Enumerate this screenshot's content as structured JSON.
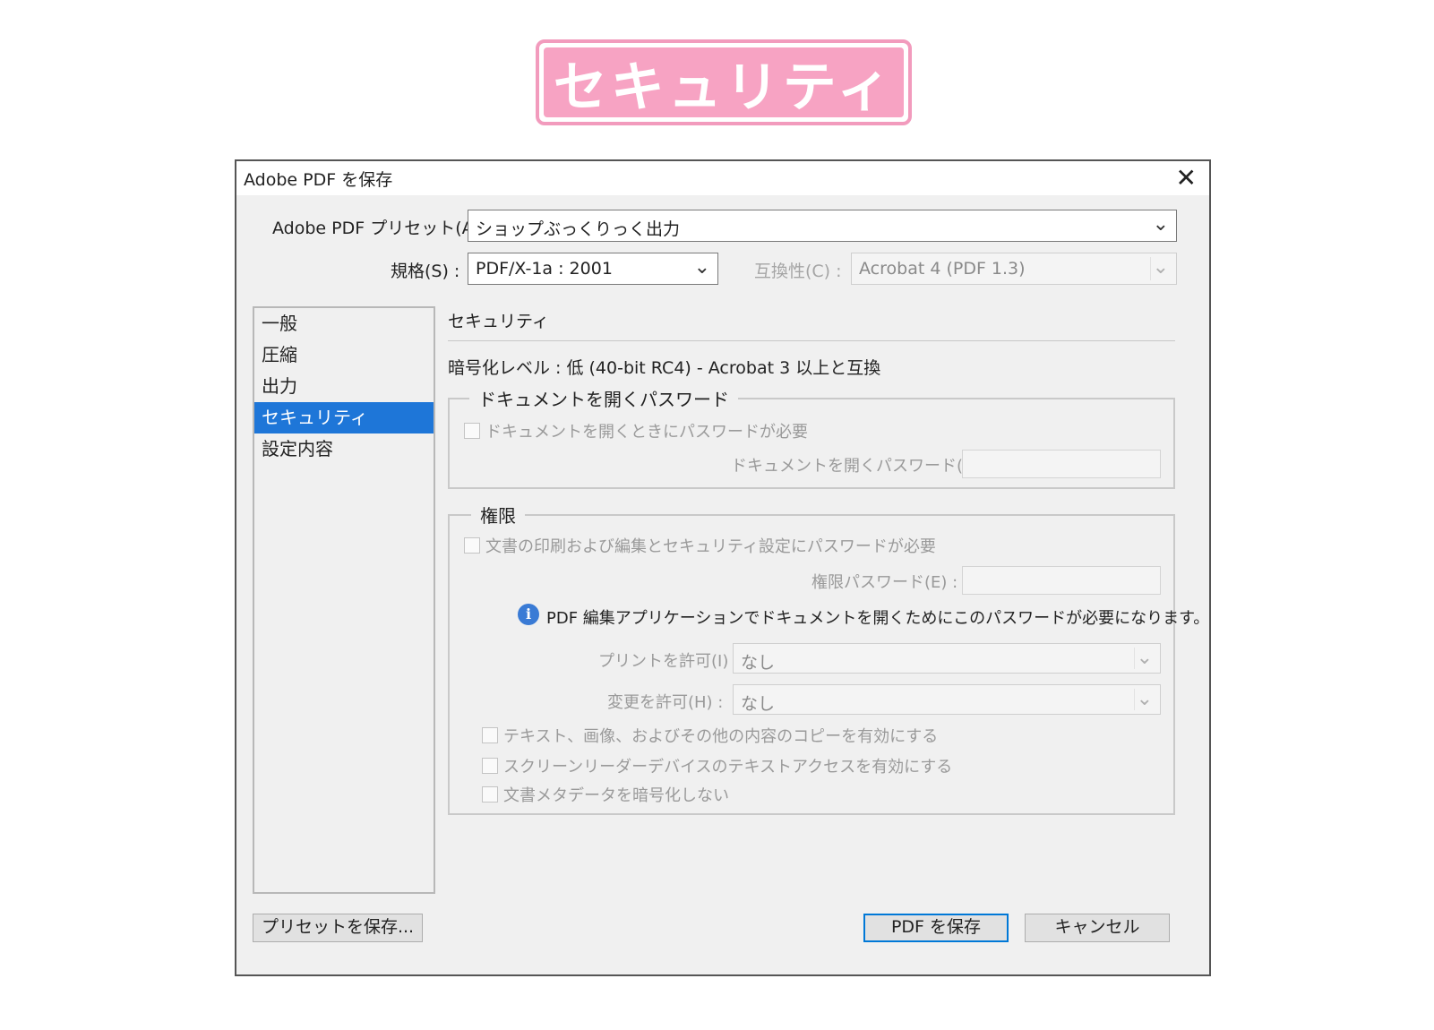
{
  "banner": {
    "title": "セキュリティ"
  },
  "dialog": {
    "title": "Adobe PDF を保存",
    "preset": {
      "label": "Adobe PDF プリセット(A) :",
      "value": "ショップぶっくりっく出力"
    },
    "standard": {
      "label": "規格(S) :",
      "value": "PDF/X-1a : 2001"
    },
    "compatibility": {
      "label": "互換性(C) :",
      "value": "Acrobat 4 (PDF 1.3)"
    }
  },
  "sidebar": {
    "items": [
      {
        "label": "一般"
      },
      {
        "label": "圧縮"
      },
      {
        "label": "出力"
      },
      {
        "label": "セキュリティ"
      },
      {
        "label": "設定内容"
      }
    ]
  },
  "security": {
    "section_title": "セキュリティ",
    "encryption_level": "暗号化レベル : 低 (40-bit RC4) - Acrobat 3 以上と互換",
    "open_password_group": {
      "legend": "ドキュメントを開くパスワード",
      "checkbox_label": "ドキュメントを開くときにパスワードが必要",
      "password_label": "ドキュメントを開くパスワード(D) :"
    },
    "permissions_group": {
      "legend": "権限",
      "checkbox_label": "文書の印刷および編集とセキュリティ設定にパスワードが必要",
      "password_label": "権限パスワード(E) :",
      "info_text": "PDF 編集アプリケーションでドキュメントを開くためにこのパスワードが必要になります。",
      "print_label": "プリントを許可(I) :",
      "print_value": "なし",
      "change_label": "変更を許可(H) :",
      "change_value": "なし",
      "options": [
        {
          "label": "テキスト、画像、およびその他の内容のコピーを有効にする"
        },
        {
          "label": "スクリーンリーダーデバイスのテキストアクセスを有効にする"
        },
        {
          "label": "文書メタデータを暗号化しない"
        }
      ]
    }
  },
  "buttons": {
    "save_preset": "プリセットを保存...",
    "save_pdf": "PDF を保存",
    "cancel": "キャンセル"
  }
}
